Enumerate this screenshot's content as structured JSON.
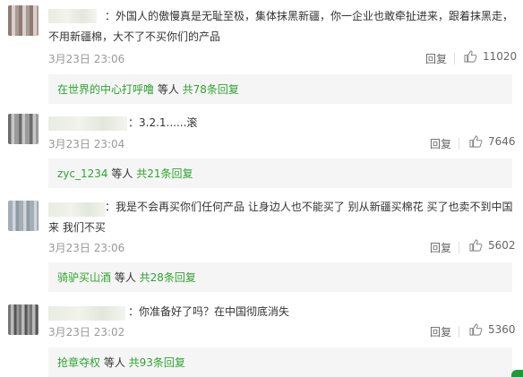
{
  "comments": [
    {
      "text_line1": "：外国人的傲慢真是无耻至极，集体抹黑新疆，你一企业也敢牵扯进来，跟着抹黑走，",
      "text_line2": "不用新疆棉，大不了不买你们的产品",
      "time": "3月23日 23:06",
      "reply_label": "回复",
      "likes": "11020",
      "replies": {
        "first_user": "在世界的中心打呼噜",
        "middle": " 等人 ",
        "total": "共78条回复"
      }
    },
    {
      "text_line1": "：3.2.1......滚",
      "text_line2": "",
      "time": "3月23日 23:04",
      "reply_label": "回复",
      "likes": "7646",
      "replies": {
        "first_user": "zyc_1234",
        "middle": " 等人 ",
        "total": "共21条回复"
      }
    },
    {
      "text_line1": "：我是不会再买你们任何产品 让身边人也不能买了 别从新疆买棉花 买了也卖不到中国",
      "text_line2": "来 我们不买",
      "time": "3月23日 23:06",
      "reply_label": "回复",
      "likes": "5602",
      "replies": {
        "first_user": "骑驴买山酒",
        "middle": " 等人 ",
        "total": "共28条回复"
      }
    },
    {
      "text_line1": "：你准备好了吗？在中国彻底消失",
      "text_line2": "",
      "time": "3月23日 23:02",
      "reply_label": "回复",
      "likes": "5360",
      "replies": {
        "first_user": "抢章夺权",
        "middle": " 等人 ",
        "total": "共93条回复"
      }
    }
  ],
  "icons": {
    "like": "thumbs-up-icon"
  },
  "colors": {
    "link": "#2da52e",
    "meta": "#999999",
    "reply_bg": "#f5f5f5"
  }
}
